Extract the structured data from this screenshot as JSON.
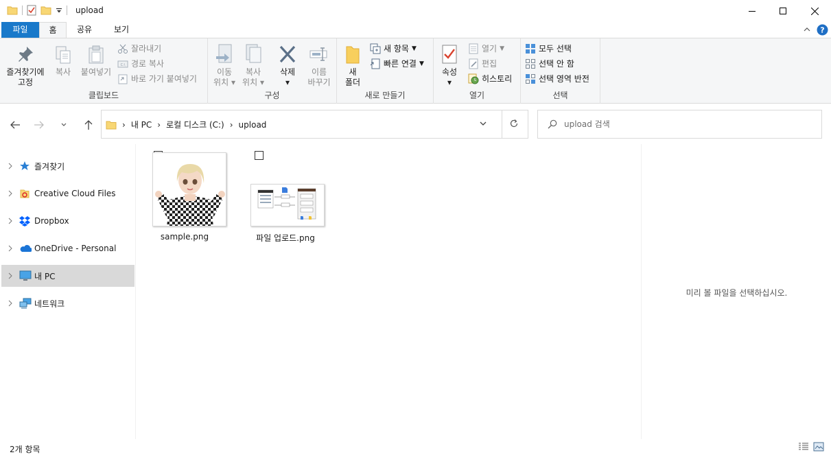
{
  "window": {
    "title": "upload"
  },
  "tabs": [
    {
      "label": "파일"
    },
    {
      "label": "홈"
    },
    {
      "label": "공유"
    },
    {
      "label": "보기"
    }
  ],
  "ribbon": {
    "clipboard": {
      "label": "클립보드",
      "pin_line1": "즐겨찾기에",
      "pin_line2": "고정",
      "copy": "복사",
      "paste": "붙여넣기",
      "cut": "잘라내기",
      "copy_path": "경로 복사",
      "paste_shortcut": "바로 가기 붙여넣기"
    },
    "organize": {
      "label": "구성",
      "move_line1": "이동",
      "move_line2": "위치",
      "copyto_line1": "복사",
      "copyto_line2": "위치",
      "delete": "삭제",
      "rename_line1": "이름",
      "rename_line2": "바꾸기"
    },
    "new": {
      "label": "새로 만들기",
      "folder_line1": "새",
      "folder_line2": "폴더",
      "new_item": "새 항목",
      "easy_access": "빠른 연결"
    },
    "open": {
      "label": "열기",
      "properties": "속성",
      "open": "열기",
      "edit": "편집",
      "history": "히스토리"
    },
    "select": {
      "label": "선택",
      "select_all": "모두 선택",
      "select_none": "선택 안 함",
      "invert": "선택 영역 반전"
    }
  },
  "address": {
    "crumbs": [
      "내 PC",
      "로컬 디스크 (C:)",
      "upload"
    ]
  },
  "search": {
    "placeholder": "upload 검색"
  },
  "nav": [
    {
      "label": "즐겨찾기",
      "icon": "star-icon"
    },
    {
      "label": "Creative Cloud Files",
      "icon": "creative-cloud-icon"
    },
    {
      "label": "Dropbox",
      "icon": "dropbox-icon"
    },
    {
      "label": "OneDrive - Personal",
      "icon": "onedrive-icon"
    },
    {
      "label": "내 PC",
      "icon": "pc-icon",
      "selected": true
    },
    {
      "label": "네트워크",
      "icon": "network-icon"
    }
  ],
  "files": [
    {
      "name": "sample.png"
    },
    {
      "name": "파일 업로드.png"
    }
  ],
  "preview": {
    "message": "미리 볼 파일을 선택하십시오."
  },
  "status": {
    "count": "2개 항목"
  },
  "colors": {
    "accent": "#1979ca",
    "selected_nav": "#d9d9d9"
  }
}
